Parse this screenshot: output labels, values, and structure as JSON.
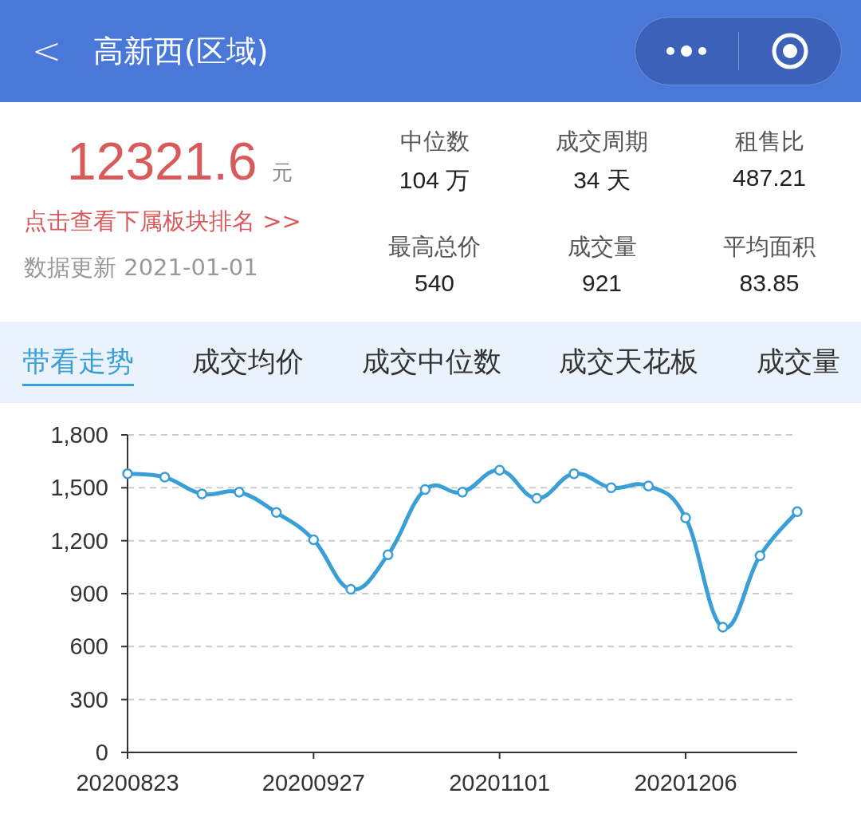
{
  "header": {
    "back": "<",
    "title": "高新西(区域)"
  },
  "summary": {
    "price": "12321.6",
    "unit": "元",
    "link": "点击查看下属板块排名 >>",
    "updated": "数据更新 2021-01-01"
  },
  "stats": [
    {
      "label": "中位数",
      "value": "104 万"
    },
    {
      "label": "成交周期",
      "value": "34 天"
    },
    {
      "label": "租售比",
      "value": "487.21"
    },
    {
      "label": "最高总价",
      "value": "540"
    },
    {
      "label": "成交量",
      "value": "921"
    },
    {
      "label": "平均面积",
      "value": "83.85"
    }
  ],
  "tabs": [
    {
      "label": "带看走势",
      "selected": true
    },
    {
      "label": "成交均价",
      "selected": false
    },
    {
      "label": "成交中位数",
      "selected": false
    },
    {
      "label": "成交天花板",
      "selected": false
    },
    {
      "label": "成交量",
      "selected": false
    }
  ],
  "chart_data": {
    "type": "line",
    "categories": [
      "20200823",
      null,
      null,
      null,
      null,
      "20200927",
      null,
      null,
      null,
      null,
      "20201101",
      null,
      null,
      null,
      null,
      "20201206",
      null,
      null,
      null
    ],
    "grid": true,
    "series": [
      {
        "color": "#3a9fd6",
        "marker": true,
        "values": [
          1580,
          1560,
          1465,
          1475,
          1360,
          1205,
          925,
          1120,
          1490,
          1475,
          1600,
          1440,
          1580,
          1500,
          1510,
          1330,
          710,
          1115,
          1365
        ]
      }
    ],
    "ylim": [
      0,
      1800
    ],
    "yticks": [
      {
        "value": 0,
        "label": "0"
      },
      {
        "value": 300,
        "label": "300"
      },
      {
        "value": 600,
        "label": "600"
      },
      {
        "value": 900,
        "label": "900"
      },
      {
        "value": 1200,
        "label": "1,200"
      },
      {
        "value": 1500,
        "label": "1,500"
      },
      {
        "value": 1800,
        "label": "1,800"
      }
    ]
  }
}
